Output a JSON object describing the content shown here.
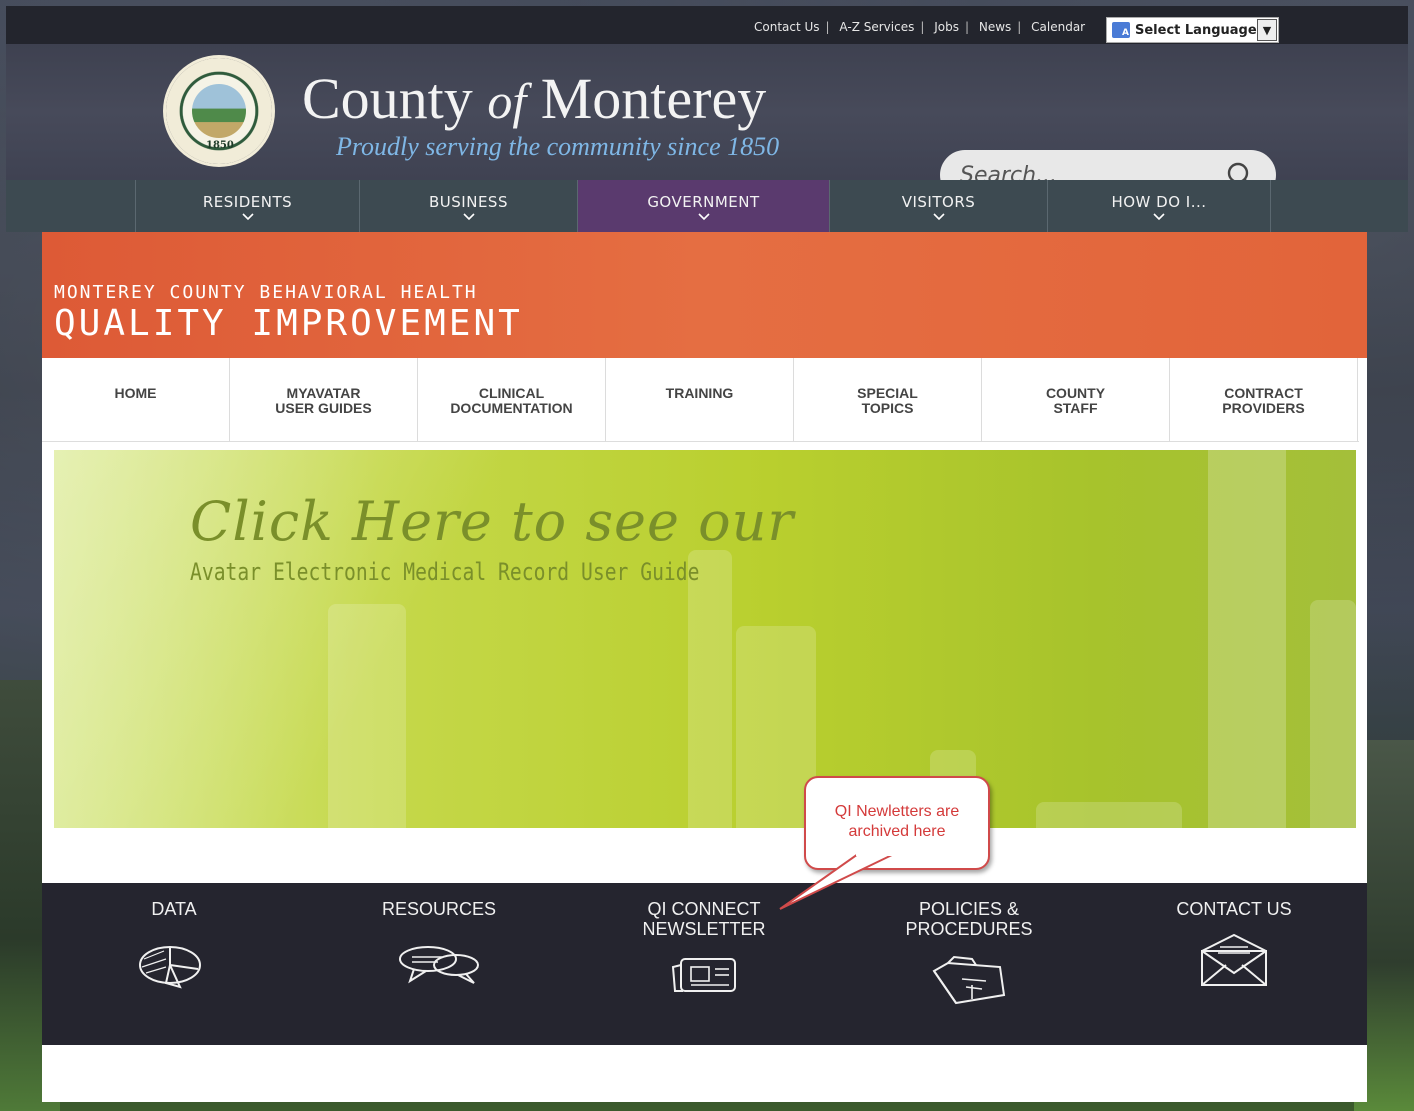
{
  "utility": {
    "links": [
      "Contact Us",
      "A-Z Services",
      "Jobs",
      "News",
      "Calendar"
    ],
    "language_label": "Select Language"
  },
  "header": {
    "seal_year": "1850",
    "title_pre": "County ",
    "title_of": "of",
    "title_post": " Monterey",
    "tagline": "Proudly serving the community since 1850",
    "search_placeholder": "Search..."
  },
  "main_nav": {
    "items": [
      "RESIDENTS",
      "BUSINESS",
      "GOVERNMENT",
      "VISITORS",
      "HOW DO I..."
    ],
    "active": "GOVERNMENT"
  },
  "banner": {
    "subtitle": "MONTEREY COUNTY BEHAVIORAL HEALTH",
    "title": "QUALITY IMPROVEMENT"
  },
  "sub_nav": {
    "items": [
      [
        "HOME"
      ],
      [
        "MYAVATAR",
        "USER GUIDES"
      ],
      [
        "CLINICAL",
        "DOCUMENTATION"
      ],
      [
        "TRAINING"
      ],
      [
        "SPECIAL",
        "TOPICS"
      ],
      [
        "COUNTY",
        "STAFF"
      ],
      [
        "CONTRACT",
        "PROVIDERS"
      ]
    ]
  },
  "hero": {
    "script_text": "Click Here to see our",
    "subtitle": "Avatar Electronic Medical Record User Guide"
  },
  "callout": {
    "line1": "QI Newletters are",
    "line2": "archived here"
  },
  "tiles": [
    {
      "lines": [
        "DATA"
      ],
      "icon": "pie-chart-icon"
    },
    {
      "lines": [
        "RESOURCES"
      ],
      "icon": "speech-bubbles-icon"
    },
    {
      "lines": [
        "QI CONNECT",
        "NEWSLETTER"
      ],
      "icon": "newspaper-icon"
    },
    {
      "lines": [
        "POLICIES &",
        "PROCEDURES"
      ],
      "icon": "folder-icon"
    },
    {
      "lines": [
        "CONTACT US"
      ],
      "icon": "envelope-icon"
    }
  ],
  "colors": {
    "banner_orange": "#e2643a",
    "nav_active_purple": "#5a3a6e",
    "hero_green": "#b9cf2e",
    "callout_red": "#d04a4a",
    "footer_dark": "#25252f"
  }
}
